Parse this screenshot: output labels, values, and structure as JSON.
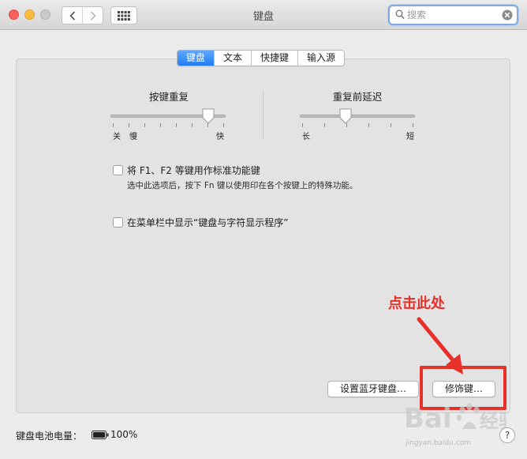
{
  "window": {
    "title": "键盘"
  },
  "search": {
    "placeholder": "搜索"
  },
  "tabs": [
    {
      "label": "键盘",
      "active": true
    },
    {
      "label": "文本",
      "active": false
    },
    {
      "label": "快捷键",
      "active": false
    },
    {
      "label": "输入源",
      "active": false
    }
  ],
  "repeat_slider": {
    "title": "按键重复",
    "labels": [
      "关",
      "慢",
      "快"
    ],
    "value_fraction": 0.85
  },
  "delay_slider": {
    "title": "重复前延迟",
    "labels": [
      "长",
      "短"
    ],
    "value_fraction": 0.4
  },
  "options": {
    "fn_keys_label": "将 F1、F2 等键用作标准功能键",
    "fn_keys_desc": "选中此选项后，按下 Fn 键以使用印在各个按键上的特殊功能。",
    "menubar_label": "在菜单栏中显示“键盘与字符显示程序”"
  },
  "buttons": {
    "bluetooth": "设置蓝牙键盘…",
    "modifier": "修饰键…"
  },
  "annotation": {
    "text": "点击此处",
    "color": "#e8302a"
  },
  "status": {
    "battery_label": "键盘电池电量：",
    "battery_value": "100%",
    "help": "?"
  },
  "watermark": {
    "sub": "jingyan.baidu.com"
  }
}
